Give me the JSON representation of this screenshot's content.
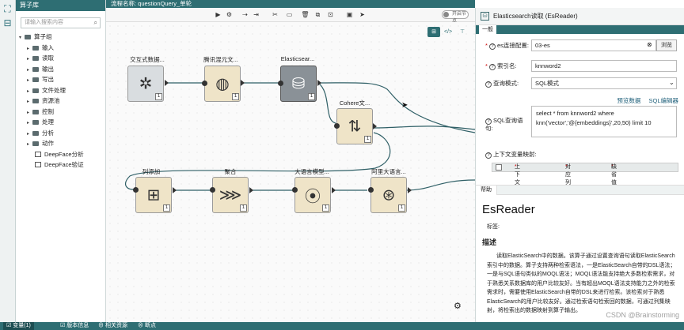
{
  "rail": {
    "icons": [
      "hierarchy-icon",
      "tree-icon"
    ]
  },
  "library": {
    "title": "算子库",
    "search_placeholder": "请输入搜索内容",
    "root_label": "算子组",
    "groups": [
      "输入",
      "读取",
      "输出",
      "写出",
      "文件处理",
      "资源池",
      "控制",
      "处理",
      "分析",
      "动作"
    ],
    "items": [
      "DeepFace分析",
      "DeepFace验证"
    ]
  },
  "canvas": {
    "process_name": "流程名称: questionQuery_单轮",
    "toggle_label": "开启节点",
    "nodes": [
      {
        "label": "交互式数据...",
        "count": "1"
      },
      {
        "label": "腾讯混元文...",
        "count": "1"
      },
      {
        "label": "Elasticsear...",
        "count": "1"
      },
      {
        "label": "Cohere文...",
        "count": "1"
      },
      {
        "label": "列添加",
        "count": "1"
      },
      {
        "label": "聚合",
        "count": "1"
      },
      {
        "label": "大语言模型...",
        "count": "1"
      },
      {
        "label": "阿里大语言...",
        "count": "1"
      }
    ]
  },
  "properties": {
    "title": "Elasticsearch读取 (EsReader)",
    "tab": "一般",
    "fields": {
      "es_config_label": "es连接配置:",
      "es_config_value": "03-es",
      "browse": "浏览",
      "index_label": "索引名:",
      "index_value": "knnword2",
      "query_mode_label": "查询模式:",
      "query_mode_value": "SQL模式",
      "preview_link": "预览数据",
      "sql_editor_link": "SQL编辑器",
      "sql_label": "SQL查询语句:",
      "sql_line1": "select * from knnword2 where",
      "sql_line2": "knn('vector','@{embeddings}',20,50) limit 10",
      "context_map_label": "上下文变量映射:",
      "grid_headers": [
        "上下文变量",
        "对应列",
        "缺省值"
      ]
    }
  },
  "help": {
    "tab": "帮助",
    "title": "EsReader",
    "tags_label": "标签:",
    "section": "描述",
    "body": "读取ElasticSearch中的数据。该算子通过设置查询语句读取ElasticSearch索引中的数据。算子支持两种检索语法，一是ElasticSearch自带的DSL语法；一是与SQL语句类似的MOQL语法；MOQL语法能支持绝大多数检索需求，对于熟悉关系数据库的用户比较友好。当有超出MOQL语法支持能力之外的检索需求时，需要使用ElasticSearch自带的DSL来进行检索。该检索对于熟悉ElasticSearch的用户比较友好。通过检索语句检索回的数据，可通过列集映射，将检索出的数据映射到算子输出。",
    "watermark": "CSDN @Brainstorming"
  },
  "bottom_tabs": [
    "变量(1)",
    "版本信息",
    "相关资源",
    "断点"
  ]
}
